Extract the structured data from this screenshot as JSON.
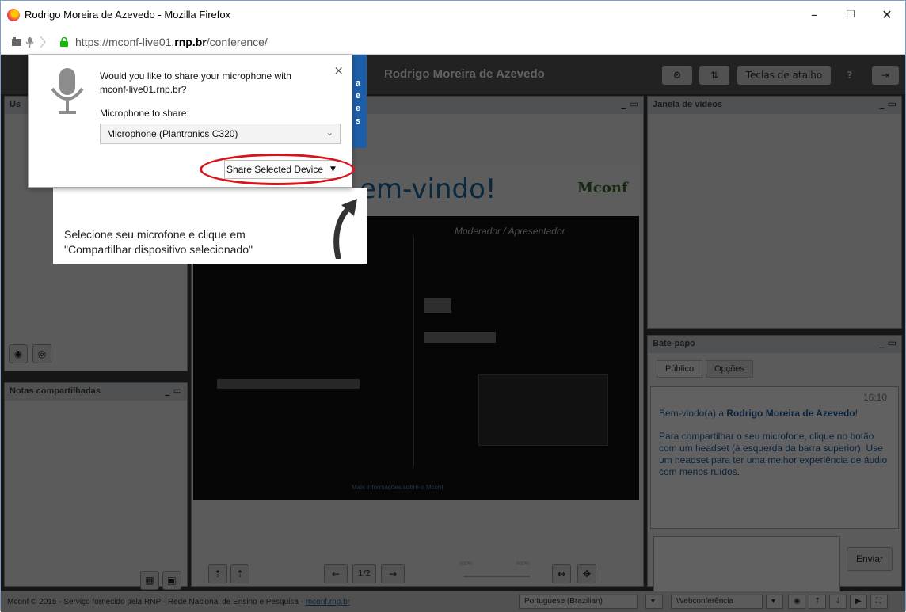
{
  "window": {
    "title": "Rodrigo Moreira de Azevedo - Mozilla Firefox",
    "minimize": "–",
    "maximize": "☐",
    "close": "✕"
  },
  "urlbar": {
    "url_prefix": "https://mconf-live01.",
    "url_bold": "rnp.br",
    "url_suffix": "/conference/"
  },
  "app": {
    "header_title": "Rodrigo Moreira de Azevedo",
    "settings_icon": "gear-icon",
    "layout_icon": "layout-icon",
    "shortcuts_label": "Teclas de atalho",
    "help_label": "?",
    "logout_icon": "logout-icon",
    "users_panel_title": "Us",
    "presentation_panel_title": "",
    "video_panel_title": "Janela de vídeos",
    "notes_panel_title": "Notas compartilhadas",
    "chat_panel_title": "Bate-papo",
    "chat_tabs": [
      "Público",
      "Opções"
    ],
    "chat_time": "16:10",
    "chat_welcome_prefix": "Bem-vindo(a) a ",
    "chat_welcome_name": "Rodrigo Moreira de Azevedo",
    "chat_welcome_suffix": "!",
    "chat_note": "Para compartilhar o seu microfone, clique no botão com um headset (à esquerda da barra superior). Use um headset para ter uma melhor experiência de áudio com menos ruídos.",
    "send_label": "Enviar",
    "slide_welcome": "em-vindo!",
    "slide_logo": "Mconf",
    "slide_subtitle": "Moderador / Apresentador",
    "slide_link": "Mais informações sobre o Mconf",
    "page_indicator": "1/2",
    "zoom_min": "100%",
    "zoom_max": "400%",
    "footer_text": "Mconf © 2015 - Serviço fornecido pela RNP - Rede Nacional de Ensino e Pesquisa - ",
    "footer_link": "mconf.rnp.br",
    "language": "Portuguese (Brazilian)",
    "layout_select": "Webconferência"
  },
  "popup": {
    "question": "Would you like to share your microphone with mconf-live01.rnp.br?",
    "label": "Microphone to share:",
    "selected_device": "Microphone (Plantronics C320)",
    "share_button": "Share Selected Device",
    "close": "×"
  },
  "callout": {
    "line1": "Selecione seu microfone e clique em",
    "line2": "\"Compartilhar dispositivo selecionado\""
  },
  "blue_strip_letters": [
    "a",
    "e",
    "e",
    "s"
  ]
}
